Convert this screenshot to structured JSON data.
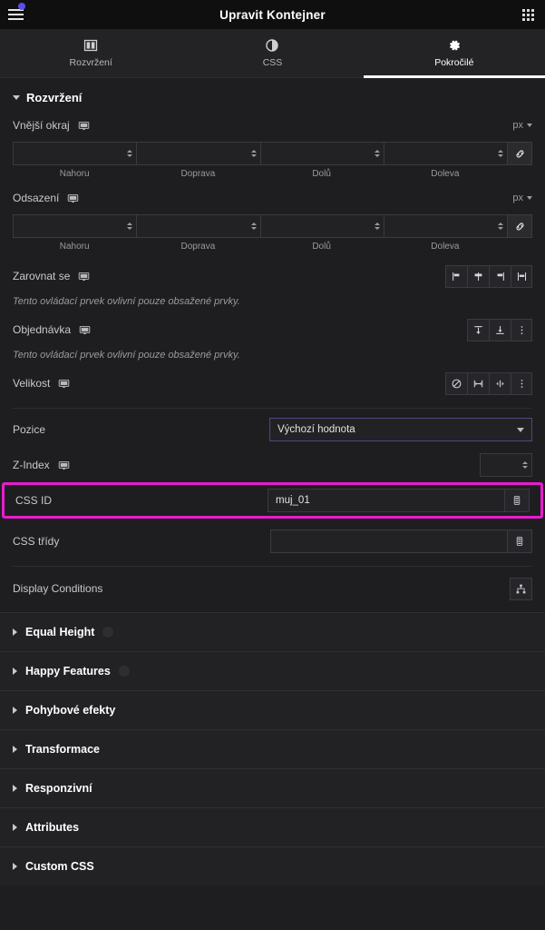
{
  "topbar": {
    "title": "Upravit Kontejner",
    "menu_icon": "hamburger-icon",
    "grid_icon": "grid-apps-icon",
    "notification_dot_color": "#5b4df0"
  },
  "tabs": [
    {
      "label": "Rozvržení",
      "icon": "columns-layout-icon",
      "active": false
    },
    {
      "label": "CSS",
      "icon": "contrast-circle-icon",
      "active": false
    },
    {
      "label": "Pokročilé",
      "icon": "gear-icon",
      "active": true
    }
  ],
  "section": {
    "title": "Rozvržení",
    "expanded": true
  },
  "controls": {
    "margin": {
      "label": "Vnější okraj",
      "device_icon": "desktop-monitor-icon",
      "unit": "px",
      "values": [
        "",
        "",
        "",
        ""
      ],
      "sides": [
        "Nahoru",
        "Doprava",
        "Dolů",
        "Doleva"
      ],
      "link_icon": "link-icon"
    },
    "padding": {
      "label": "Odsazení",
      "device_icon": "desktop-monitor-icon",
      "unit": "px",
      "values": [
        "",
        "",
        "",
        ""
      ],
      "sides": [
        "Nahoru",
        "Doprava",
        "Dolů",
        "Doleva"
      ],
      "link_icon": "link-icon"
    },
    "align": {
      "label": "Zarovnat se",
      "device_icon": "desktop-monitor-icon",
      "hint": "Tento ovládací prvek ovlivní pouze obsažené prvky.",
      "options": [
        "align-start-icon",
        "align-center-icon",
        "align-end-icon",
        "align-stretch-icon"
      ]
    },
    "order": {
      "label": "Objednávka",
      "device_icon": "desktop-monitor-icon",
      "hint": "Tento ovládací prvek ovlivní pouze obsažené prvky.",
      "options": [
        "order-first-icon",
        "order-last-icon",
        "more-options-icon"
      ]
    },
    "size": {
      "label": "Velikost",
      "device_icon": "desktop-monitor-icon",
      "options": [
        "none-icon",
        "full-width-icon",
        "fit-content-icon",
        "more-options-icon"
      ]
    },
    "position": {
      "label": "Pozice",
      "value": "Výchozí hodnota",
      "chevron_icon": "chevron-down-icon"
    },
    "zindex": {
      "label": "Z-Index",
      "device_icon": "desktop-monitor-icon",
      "value": ""
    },
    "css_id": {
      "label": "CSS ID",
      "value": "muj_01",
      "dynamic_icon": "database-stack-icon",
      "highlight_color": "#e81ccd"
    },
    "css_classes": {
      "label": "CSS třídy",
      "value": "",
      "dynamic_icon": "database-stack-icon"
    },
    "display_conditions": {
      "label": "Display Conditions",
      "icon": "sitemap-hierarchy-icon"
    }
  },
  "accordions": [
    {
      "label": "Equal Height",
      "badge": true,
      "badge_icon": "pro-lock-icon"
    },
    {
      "label": "Happy Features",
      "badge": true,
      "badge_icon": "pro-lock-icon"
    },
    {
      "label": "Pohybové efekty",
      "badge": false
    },
    {
      "label": "Transformace",
      "badge": false
    },
    {
      "label": "Responzivní",
      "badge": false
    },
    {
      "label": "Attributes",
      "badge": false
    },
    {
      "label": "Custom CSS",
      "badge": false
    }
  ]
}
